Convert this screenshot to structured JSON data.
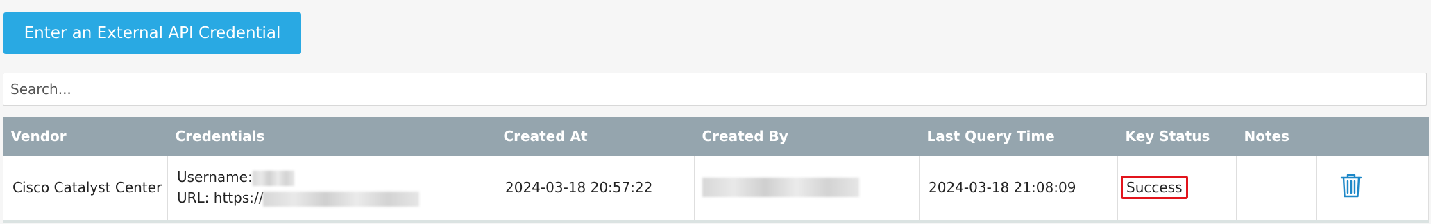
{
  "toolbar": {
    "add_credential_label": "Enter an External API Credential"
  },
  "search": {
    "placeholder": "Search..."
  },
  "table": {
    "headers": [
      "Vendor",
      "Credentials",
      "Created At",
      "Created By",
      "Last Query Time",
      "Key Status",
      "Notes",
      ""
    ],
    "rows": [
      {
        "vendor": "Cisco Catalyst Center",
        "username_label": "Username:",
        "url_label": "URL: https://",
        "created_at": "2024-03-18 20:57:22",
        "last_query_time": "2024-03-18 21:08:09",
        "key_status": "Success",
        "notes": ""
      }
    ]
  },
  "colors": {
    "accent": "#29a9e3",
    "header_bg": "#95a5ae",
    "status_outline": "#e2141c",
    "delete_icon": "#1e88c8"
  },
  "icons": {
    "delete": "trash-icon"
  }
}
